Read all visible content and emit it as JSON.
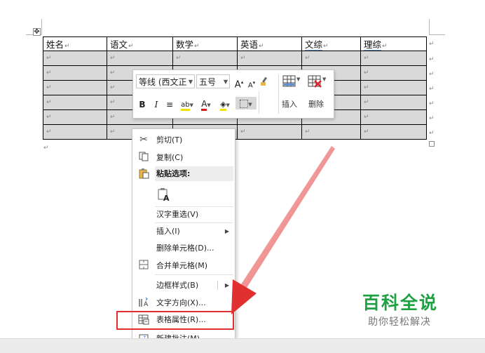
{
  "table": {
    "headers": [
      "姓名",
      "语文",
      "数学",
      "英语",
      "文综",
      "理综"
    ],
    "rows": 6,
    "cell_mark": "↵",
    "row_end_mark": "↵"
  },
  "move_handle": "✥",
  "mini_toolbar": {
    "font_name": "等线 (西文正",
    "font_size": "五号",
    "grow_font": "A",
    "shrink_font": "A",
    "bold": "B",
    "italic": "I",
    "align": "≡",
    "highlight": "ab",
    "font_color": "A",
    "insert_label": "插入",
    "delete_label": "删除"
  },
  "context_menu": {
    "items": [
      {
        "label": "剪切(T)",
        "icon": "scissors-icon"
      },
      {
        "label": "复制(C)",
        "icon": "copy-icon"
      },
      {
        "label": "粘贴选项:",
        "icon": "paste-icon"
      },
      {
        "label": "",
        "icon": "paste-text-only-icon"
      },
      {
        "label": "汉字重选(V)",
        "icon": ""
      },
      {
        "label": "插入(I)",
        "icon": ""
      },
      {
        "label": "删除单元格(D)...",
        "icon": ""
      },
      {
        "label": "合并单元格(M)",
        "icon": "merge-cells-icon"
      },
      {
        "label": "边框样式(B)",
        "icon": ""
      },
      {
        "label": "文字方向(X)...",
        "icon": "text-direction-icon"
      },
      {
        "label": "表格属性(R)...",
        "icon": "table-properties-icon"
      },
      {
        "label": "新建批注(M)",
        "icon": "new-comment-icon"
      }
    ]
  },
  "watermark": {
    "title": "百科全说",
    "subtitle": "助你轻松解决"
  },
  "colors": {
    "cell_shading": "#d9d9d9",
    "highlight_border": "#e0302f",
    "watermark_green": "#1fa143"
  }
}
